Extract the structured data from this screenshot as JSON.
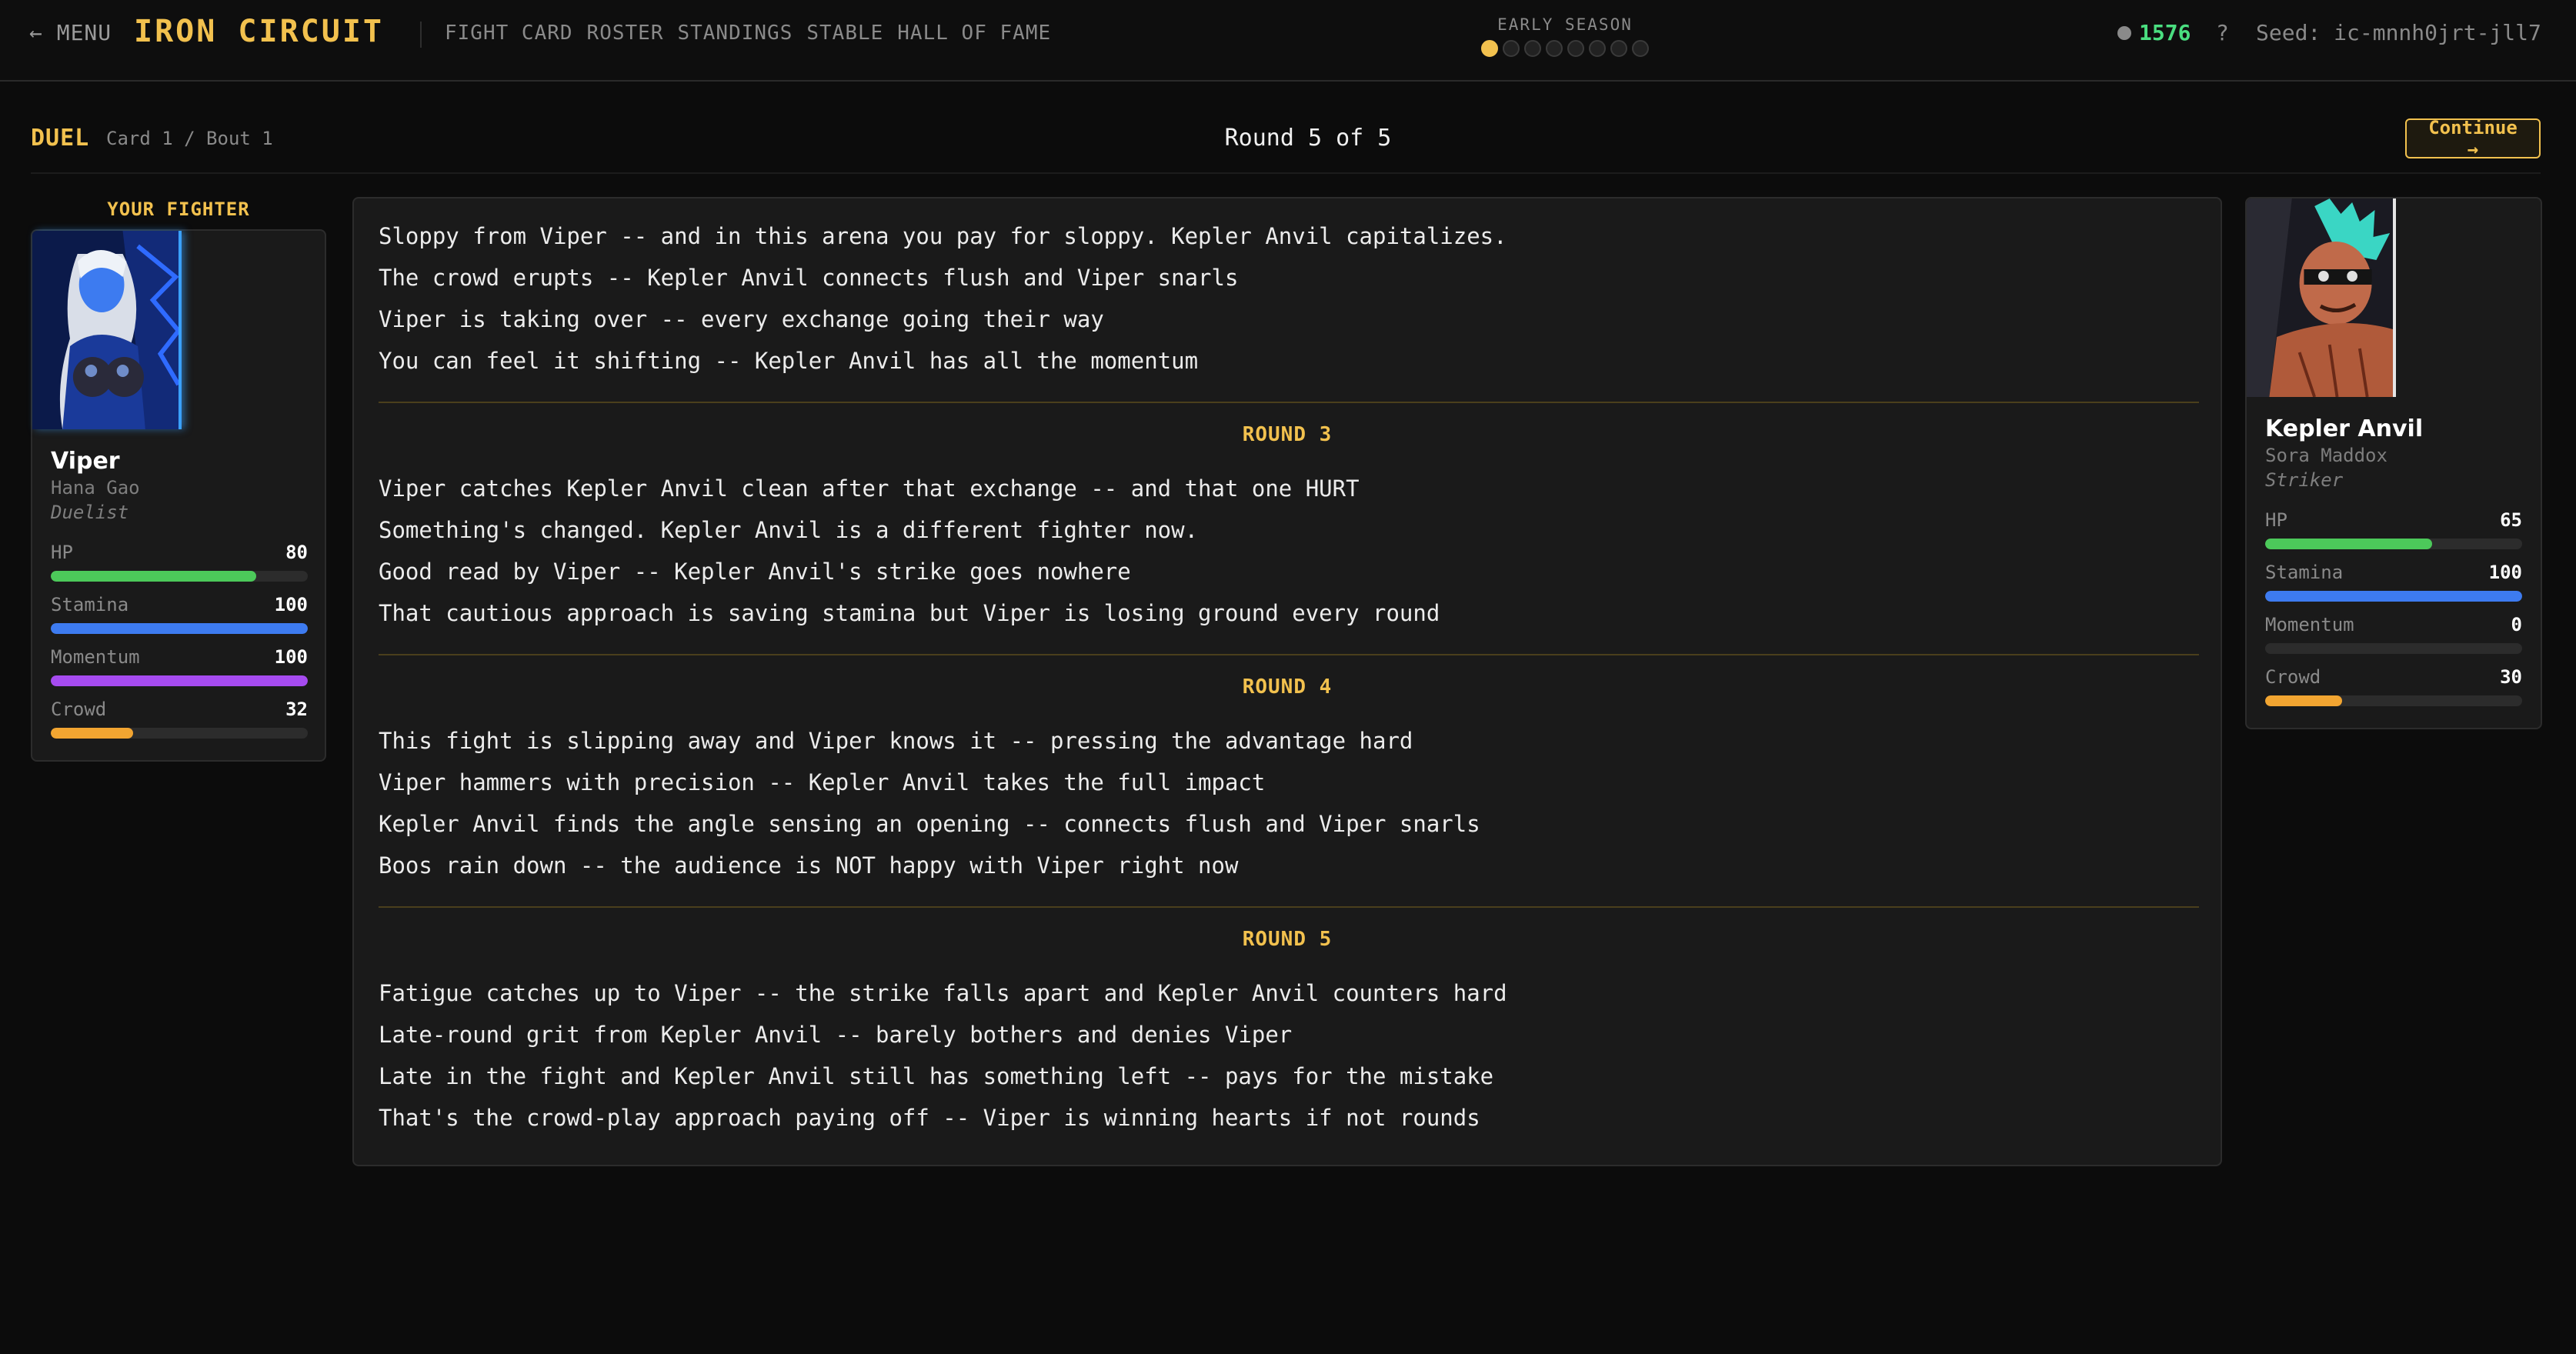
{
  "topbar": {
    "menu_label": "← MENU",
    "brand": "IRON CIRCUIT",
    "nav": [
      "FIGHT CARD",
      "ROSTER",
      "STANDINGS",
      "STABLE",
      "HALL OF FAME"
    ],
    "season_label": "EARLY SEASON",
    "season_progress": {
      "current": 1,
      "total": 8
    },
    "currency": "1576",
    "help_label": "?",
    "seed_text": "Seed: ic-mnnh0jrt-jll7"
  },
  "duel": {
    "title": "DUEL",
    "subtitle": "Card 1 / Bout 1",
    "round_text": "Round 5 of 5",
    "continue_label": "Continue →"
  },
  "player": {
    "section_label": "YOUR FIGHTER",
    "name": "Viper",
    "real_name": "Hana Gao",
    "style": "Duelist",
    "stats": [
      {
        "label": "HP",
        "value": 80,
        "max": 100,
        "color": "#4cc95a"
      },
      {
        "label": "Stamina",
        "value": 100,
        "max": 100,
        "color": "#3d7bf0"
      },
      {
        "label": "Momentum",
        "value": 100,
        "max": 100,
        "color": "#a64bf0"
      },
      {
        "label": "Crowd",
        "value": 32,
        "max": 100,
        "color": "#f2a531"
      }
    ]
  },
  "opponent": {
    "name": "Kepler Anvil",
    "real_name": "Sora Maddox",
    "style": "Striker",
    "stats": [
      {
        "label": "HP",
        "value": 65,
        "max": 100,
        "color": "#4cc95a"
      },
      {
        "label": "Stamina",
        "value": 100,
        "max": 100,
        "color": "#3d7bf0"
      },
      {
        "label": "Momentum",
        "value": 0,
        "max": 100,
        "color": "#a64bf0"
      },
      {
        "label": "Crowd",
        "value": 30,
        "max": 100,
        "color": "#f2a531"
      }
    ]
  },
  "log": {
    "intro_lines": [
      "Sloppy from Viper -- and in this arena you pay for sloppy. Kepler Anvil capitalizes.",
      "The crowd erupts -- Kepler Anvil connects flush and Viper snarls",
      "Viper is taking over -- every exchange going their way",
      "You can feel it shifting -- Kepler Anvil has all the momentum"
    ],
    "rounds": [
      {
        "label": "ROUND 3",
        "lines": [
          "Viper catches Kepler Anvil clean after that exchange -- and that one HURT",
          "Something's changed. Kepler Anvil is a different fighter now.",
          "Good read by Viper -- Kepler Anvil's strike goes nowhere",
          "That cautious approach is saving stamina but Viper is losing ground every round"
        ]
      },
      {
        "label": "ROUND 4",
        "lines": [
          "This fight is slipping away and Viper knows it -- pressing the advantage hard",
          "Viper hammers with precision -- Kepler Anvil takes the full impact",
          "Kepler Anvil finds the angle sensing an opening -- connects flush and Viper snarls",
          "Boos rain down -- the audience is NOT happy with Viper right now"
        ]
      },
      {
        "label": "ROUND 5",
        "lines": [
          "Fatigue catches up to Viper -- the strike falls apart and Kepler Anvil counters hard",
          "Late-round grit from Kepler Anvil -- barely bothers and denies Viper",
          "Late in the fight and Kepler Anvil still has something left -- pays for the mistake",
          "That's the crowd-play approach paying off -- Viper is winning hearts if not rounds"
        ]
      }
    ]
  },
  "colors": {
    "accent": "#f2c14e",
    "currency": "#4ade80",
    "background": "#0c0c0c",
    "panel": "#1a1a1a"
  }
}
